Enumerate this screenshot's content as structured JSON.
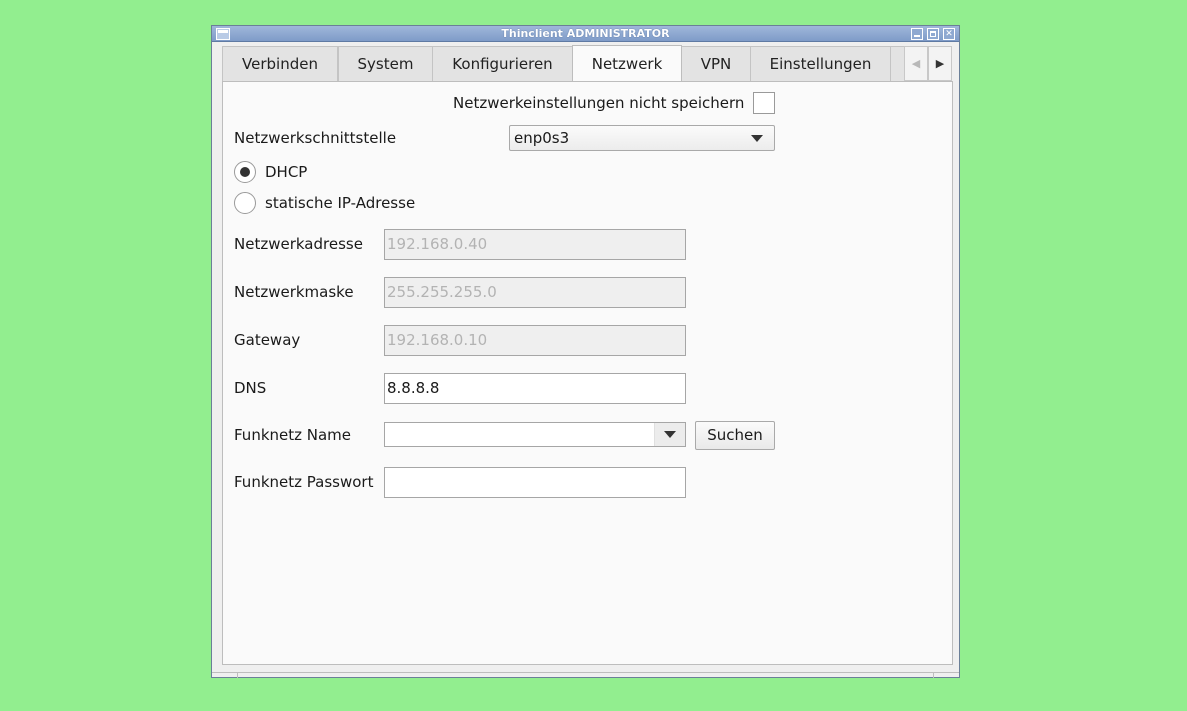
{
  "window": {
    "title": "Thinclient ADMINISTRATOR"
  },
  "tabs": [
    {
      "label": "Verbinden",
      "active": false
    },
    {
      "label": "System",
      "active": false
    },
    {
      "label": "Konfigurieren",
      "active": false
    },
    {
      "label": "Netzwerk",
      "active": true
    },
    {
      "label": "VPN",
      "active": false
    },
    {
      "label": "Einstellungen",
      "active": false
    },
    {
      "label": "",
      "active": false
    }
  ],
  "form": {
    "no_save_label": "Netzwerkeinstellungen nicht speichern",
    "no_save_checked": false,
    "interface_label": "Netzwerkschnittstelle",
    "interface_value": "enp0s3",
    "dhcp_label": "DHCP",
    "static_label": "statische IP-Adresse",
    "mode": "DHCP",
    "address_label": "Netzwerkadresse",
    "address_value": "192.168.0.40",
    "netmask_label": "Netzwerkmaske",
    "netmask_value": "255.255.255.0",
    "gateway_label": "Gateway",
    "gateway_value": "192.168.0.10",
    "dns_label": "DNS",
    "dns_value": "8.8.8.8",
    "wifi_name_label": "Funknetz Name",
    "wifi_name_value": "",
    "search_button": "Suchen",
    "wifi_password_label": "Funknetz Passwort",
    "wifi_password_value": ""
  },
  "icons": {
    "window_menu": "window-menu-icon",
    "minimize": "minimize-icon",
    "maximize": "maximize-icon",
    "close": "close-icon",
    "tab_scroll_left": "chevron-left-icon",
    "tab_scroll_right": "chevron-right-icon",
    "dropdown": "chevron-down-icon"
  },
  "colors": {
    "desktop_background": "#92ee8f",
    "titlebar": "#8fa9d1"
  }
}
